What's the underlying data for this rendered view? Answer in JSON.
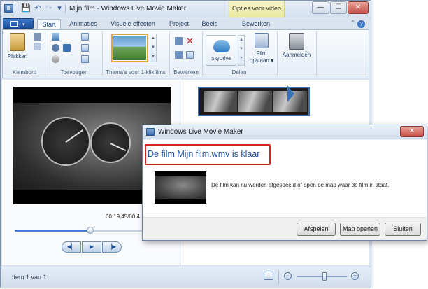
{
  "window": {
    "title": "Mijn film - Windows Live Movie Maker",
    "context_tab_header": "Opties voor video",
    "minimize_glyph": "—",
    "maximize_glyph": "☐",
    "close_glyph": "✕"
  },
  "quick_access": {
    "save_icon": "💾",
    "undo_icon": "↶",
    "redo_icon": "↷",
    "dropdown_icon": "▾"
  },
  "ribbon_tabs": [
    {
      "label": "Start",
      "active": true
    },
    {
      "label": "Animaties",
      "active": false
    },
    {
      "label": "Visuele effecten",
      "active": false
    },
    {
      "label": "Project",
      "active": false
    },
    {
      "label": "Beeld",
      "active": false
    },
    {
      "label": "Bewerken",
      "active": false
    }
  ],
  "help": "?",
  "ribbon": {
    "paste_label": "Plakken",
    "groups": {
      "clipboard": "Klembord",
      "add": "Toevoegen",
      "themes": "Thema's voor 1-klikfilms",
      "edit": "Bewerken",
      "share": "Delen"
    },
    "skydrive_label": "SkyDrive",
    "save_movie_line1": "Film",
    "save_movie_line2": "opslaan ▾",
    "sign_in_label": "Aanmelden"
  },
  "player": {
    "timecode": "00:19,45/00:4",
    "progress": 0.48,
    "prev_glyph": "◀▏",
    "play_glyph": "▶",
    "next_glyph": "▕▶"
  },
  "status": {
    "item_text": "Item 1 van 1",
    "zoom_out": "−",
    "zoom_in": "+",
    "zoom_level": 0.55
  },
  "dialog": {
    "title": "Windows Live Movie Maker",
    "close_glyph": "✕",
    "heading": "De film Mijn film.wmv is klaar",
    "message": "De film kan nu worden afgespeeld of open de map waar de film in staat.",
    "buttons": {
      "play": "Afspelen",
      "open_folder": "Map openen",
      "close": "Sluiten"
    }
  },
  "colors": {
    "accent": "#1f4f9c",
    "highlight": "#d42424",
    "window_frame": "#dbe4ee"
  }
}
